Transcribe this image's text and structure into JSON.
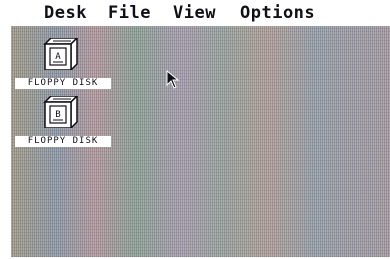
{
  "menubar": {
    "items": [
      {
        "label": "Desk"
      },
      {
        "label": "File"
      },
      {
        "label": "View"
      },
      {
        "label": "Options"
      }
    ]
  },
  "desktop": {
    "icons": [
      {
        "label": "FLOPPY DISK",
        "drive_letter": "A",
        "icon": "drive-cabinet-icon"
      },
      {
        "label": "FLOPPY DISK",
        "drive_letter": "B",
        "icon": "drive-cabinet-icon"
      }
    ]
  },
  "cursor": {
    "icon": "mouse-pointer-arrow"
  },
  "colors": {
    "menubar_bg": "#ffffff",
    "text": "#101018",
    "desktop": "#8e95a2"
  }
}
